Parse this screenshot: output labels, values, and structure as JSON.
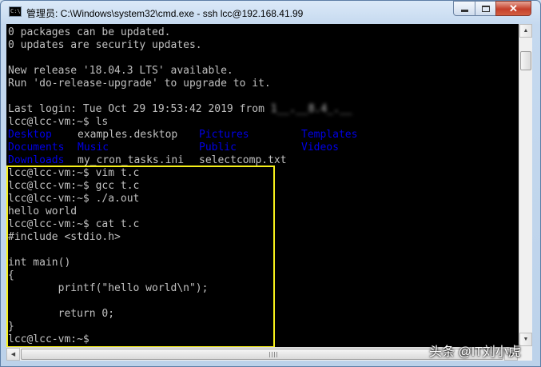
{
  "window": {
    "title": "管理员: C:\\Windows\\system32\\cmd.exe - ssh  lcc@192.168.41.99",
    "icon": "console-app-icon",
    "minimize_symbol": "",
    "maximize_symbol": "",
    "close_symbol": "✕"
  },
  "terminal": {
    "line_0": "0 packages can be updated.",
    "line_1": "0 updates are security updates.",
    "line_2": "",
    "line_3": "New release '18.04.3 LTS' available.",
    "line_4": "Run 'do-release-upgrade' to upgrade to it.",
    "line_5": "",
    "login_prefix": "Last login: Tue Oct 29 19:53:42 2019 from ",
    "login_host_blurred": "1__.__8.4_.__",
    "line_7": "lcc@lcc-vm:~$ ls",
    "ls": {
      "row1": [
        "Desktop",
        "examples.desktop",
        "Pictures",
        "Templates"
      ],
      "row2": [
        "Documents",
        "Music",
        "Public",
        "Videos"
      ],
      "row3": [
        "Downloads",
        "my_cron_tasks.ini",
        "selectcomp.txt"
      ]
    },
    "line_11": "lcc@lcc-vm:~$ vim t.c",
    "line_12": "lcc@lcc-vm:~$ gcc t.c",
    "line_13": "lcc@lcc-vm:~$ ./a.out",
    "line_14": "hello world",
    "line_15": "lcc@lcc-vm:~$ cat t.c",
    "line_16": "#include <stdio.h>",
    "line_17": "",
    "line_18": "int main()",
    "line_19": "{",
    "line_20": "        printf(\"hello world\\n\");",
    "line_21": "",
    "line_22": "        return 0;",
    "line_23": "}",
    "line_24": "lcc@lcc-vm:~$"
  },
  "colors": {
    "terminal_bg": "#000000",
    "terminal_fg": "#c0c0c0",
    "directory_blue": "#0000e6",
    "highlight_box": "#f7f01a"
  },
  "scrollbars": {
    "up_arrow": "▲",
    "down_arrow": "▼",
    "left_arrow": "◀",
    "right_arrow": "▶"
  },
  "watermark": "头条 @IT刘小虎"
}
